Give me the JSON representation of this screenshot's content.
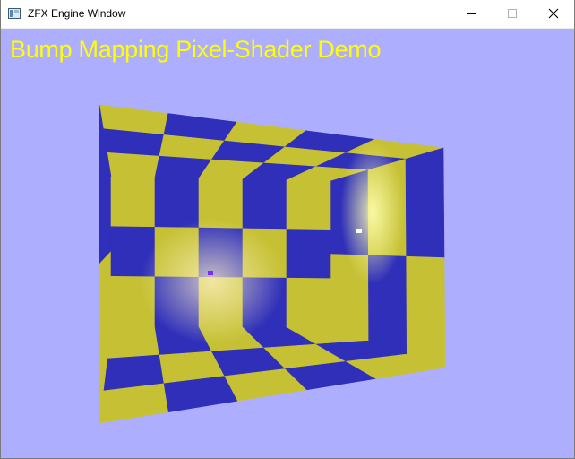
{
  "window": {
    "title": "ZFX Engine Window",
    "icon": "app-window-icon",
    "controls": [
      "minimize-icon",
      "maximize-icon",
      "close-icon"
    ]
  },
  "viewport": {
    "overlay_text": "Bump Mapping Pixel-Shader Demo",
    "background_color": "#aeaeff",
    "text_color": "#ffff00",
    "checker_colors": [
      "#c6c134",
      "#2f2fb9"
    ]
  }
}
